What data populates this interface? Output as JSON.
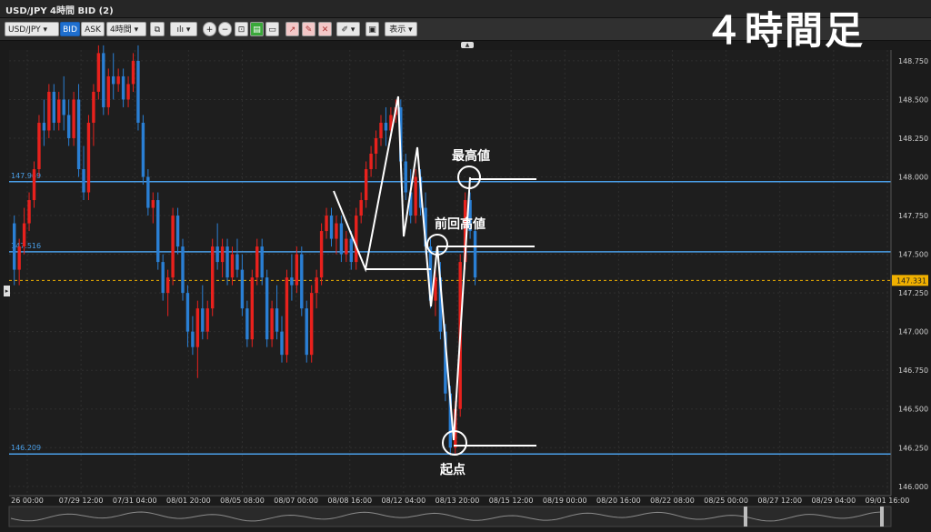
{
  "window": {
    "title": "USD/JPY 4時間 BID (2)"
  },
  "toolbar": {
    "symbol": "USD/JPY",
    "bid": "BID",
    "ask": "ASK",
    "timeframe": "4時間",
    "display": "表示"
  },
  "watermark": "４時間足",
  "colors": {
    "up": "#e8211d",
    "down": "#2a7fd4",
    "hline": "#4a9fe8",
    "annotation": "#ffffff",
    "current": "#f0b000"
  },
  "chart_data": {
    "type": "candlestick",
    "ylim": [
      145.94,
      148.82
    ],
    "yticks": [
      "148.750",
      "148.500",
      "148.250",
      "148.000",
      "147.750",
      "147.500",
      "147.250",
      "147.000",
      "146.750",
      "146.500",
      "146.250",
      "146.000"
    ],
    "xticks": [
      "26 00:00",
      "07/29 12:00",
      "07/31 04:00",
      "08/01 20:00",
      "08/05 08:00",
      "08/07 00:00",
      "08/08 16:00",
      "08/12 04:00",
      "08/13 20:00",
      "08/15 12:00",
      "08/19 00:00",
      "08/20 16:00",
      "08/22 08:00",
      "08/25 00:00",
      "08/27 12:00",
      "08/29 04:00",
      "09/01 16:00"
    ],
    "current_price": "147.331",
    "horizontal_lines": [
      {
        "label": "147.969",
        "value": 147.969
      },
      {
        "label": "147.516",
        "value": 147.516
      },
      {
        "label": "146.209",
        "value": 146.209
      }
    ],
    "annotations": [
      {
        "text": "最高値"
      },
      {
        "text": "前回高値"
      },
      {
        "text": "起点"
      }
    ],
    "candles": [
      [
        147.7,
        147.75,
        147.3,
        147.4
      ],
      [
        147.4,
        147.6,
        147.3,
        147.55
      ],
      [
        147.55,
        147.8,
        147.5,
        147.7
      ],
      [
        147.7,
        147.9,
        147.65,
        147.85
      ],
      [
        147.85,
        148.1,
        147.8,
        148.05
      ],
      [
        148.05,
        148.4,
        148.0,
        148.35
      ],
      [
        148.35,
        148.5,
        148.2,
        148.3
      ],
      [
        148.3,
        148.6,
        148.25,
        148.55
      ],
      [
        148.55,
        148.6,
        148.3,
        148.35
      ],
      [
        148.35,
        148.55,
        148.3,
        148.5
      ],
      [
        148.5,
        148.65,
        148.3,
        148.4
      ],
      [
        148.4,
        148.5,
        148.2,
        148.25
      ],
      [
        148.25,
        148.55,
        148.2,
        148.5
      ],
      [
        148.5,
        148.6,
        148.0,
        148.05
      ],
      [
        148.05,
        148.2,
        147.85,
        147.9
      ],
      [
        147.9,
        148.4,
        147.85,
        148.35
      ],
      [
        148.35,
        148.6,
        148.2,
        148.55
      ],
      [
        148.55,
        148.85,
        148.5,
        148.8
      ],
      [
        148.8,
        148.85,
        148.4,
        148.45
      ],
      [
        148.45,
        148.7,
        148.4,
        148.65
      ],
      [
        148.65,
        148.8,
        148.5,
        148.6
      ],
      [
        148.6,
        148.7,
        148.55,
        148.65
      ],
      [
        148.65,
        148.7,
        148.45,
        148.5
      ],
      [
        148.5,
        148.65,
        148.45,
        148.6
      ],
      [
        148.6,
        148.8,
        148.55,
        148.75
      ],
      [
        148.75,
        148.85,
        148.3,
        148.35
      ],
      [
        148.35,
        148.4,
        147.95,
        148.0
      ],
      [
        148.0,
        148.05,
        147.75,
        147.8
      ],
      [
        147.8,
        147.9,
        147.7,
        147.85
      ],
      [
        147.85,
        147.9,
        147.4,
        147.45
      ],
      [
        147.45,
        147.5,
        147.2,
        147.25
      ],
      [
        147.25,
        147.4,
        147.1,
        147.35
      ],
      [
        147.35,
        147.8,
        147.3,
        147.75
      ],
      [
        147.75,
        147.8,
        147.5,
        147.55
      ],
      [
        147.55,
        147.6,
        147.2,
        147.25
      ],
      [
        147.25,
        147.3,
        146.9,
        147.0
      ],
      [
        147.0,
        147.1,
        146.85,
        146.9
      ],
      [
        146.9,
        147.2,
        146.7,
        147.15
      ],
      [
        147.15,
        147.3,
        146.95,
        147.0
      ],
      [
        147.0,
        147.2,
        146.95,
        147.15
      ],
      [
        147.15,
        147.6,
        147.1,
        147.55
      ],
      [
        147.55,
        147.7,
        147.4,
        147.45
      ],
      [
        147.45,
        147.6,
        147.35,
        147.55
      ],
      [
        147.55,
        147.6,
        147.3,
        147.35
      ],
      [
        147.35,
        147.55,
        147.3,
        147.5
      ],
      [
        147.5,
        147.6,
        147.35,
        147.4
      ],
      [
        147.4,
        147.5,
        147.1,
        147.15
      ],
      [
        147.15,
        147.2,
        146.9,
        146.95
      ],
      [
        146.95,
        147.4,
        146.9,
        147.35
      ],
      [
        147.35,
        147.6,
        147.3,
        147.55
      ],
      [
        147.55,
        147.6,
        147.3,
        147.35
      ],
      [
        147.35,
        147.4,
        146.9,
        146.95
      ],
      [
        146.95,
        147.2,
        146.9,
        147.15
      ],
      [
        147.15,
        147.3,
        146.95,
        147.0
      ],
      [
        147.0,
        147.1,
        146.8,
        146.85
      ],
      [
        146.85,
        147.4,
        146.8,
        147.35
      ],
      [
        147.35,
        147.5,
        147.2,
        147.3
      ],
      [
        147.3,
        147.55,
        147.25,
        147.5
      ],
      [
        147.5,
        147.55,
        147.1,
        147.15
      ],
      [
        147.15,
        147.2,
        146.8,
        146.85
      ],
      [
        146.85,
        147.3,
        146.8,
        147.25
      ],
      [
        147.25,
        147.4,
        147.15,
        147.35
      ],
      [
        147.35,
        147.7,
        147.3,
        147.65
      ],
      [
        147.65,
        147.8,
        147.6,
        147.75
      ],
      [
        147.75,
        147.8,
        147.55,
        147.6
      ],
      [
        147.6,
        147.75,
        147.5,
        147.7
      ],
      [
        147.7,
        147.75,
        147.45,
        147.5
      ],
      [
        147.5,
        147.65,
        147.45,
        147.6
      ],
      [
        147.6,
        147.65,
        147.4,
        147.45
      ],
      [
        147.45,
        147.8,
        147.4,
        147.75
      ],
      [
        147.75,
        147.9,
        147.7,
        147.85
      ],
      [
        147.85,
        148.1,
        147.8,
        148.05
      ],
      [
        148.05,
        148.2,
        148.0,
        148.15
      ],
      [
        148.15,
        148.3,
        148.05,
        148.25
      ],
      [
        148.25,
        148.4,
        148.2,
        148.35
      ],
      [
        148.35,
        148.45,
        148.2,
        148.3
      ],
      [
        148.3,
        148.45,
        148.25,
        148.4
      ],
      [
        148.4,
        148.5,
        148.35,
        148.45
      ],
      [
        148.45,
        148.5,
        148.05,
        148.1
      ],
      [
        148.1,
        148.15,
        147.85,
        147.9
      ],
      [
        147.9,
        148.05,
        147.7,
        147.75
      ],
      [
        147.75,
        148.05,
        147.7,
        148.0
      ],
      [
        148.0,
        148.05,
        147.75,
        147.8
      ],
      [
        147.8,
        147.9,
        147.5,
        147.55
      ],
      [
        147.55,
        147.6,
        147.15,
        147.2
      ],
      [
        147.2,
        147.4,
        147.1,
        147.35
      ],
      [
        147.35,
        147.45,
        146.95,
        147.0
      ],
      [
        147.0,
        147.05,
        146.55,
        146.6
      ],
      [
        146.6,
        146.65,
        146.2,
        146.25
      ],
      [
        146.25,
        146.55,
        146.2,
        146.5
      ],
      [
        146.5,
        147.5,
        146.45,
        147.45
      ],
      [
        147.45,
        147.9,
        147.4,
        147.85
      ],
      [
        147.85,
        147.9,
        147.6,
        147.65
      ],
      [
        147.65,
        147.7,
        147.3,
        147.35
      ]
    ]
  }
}
